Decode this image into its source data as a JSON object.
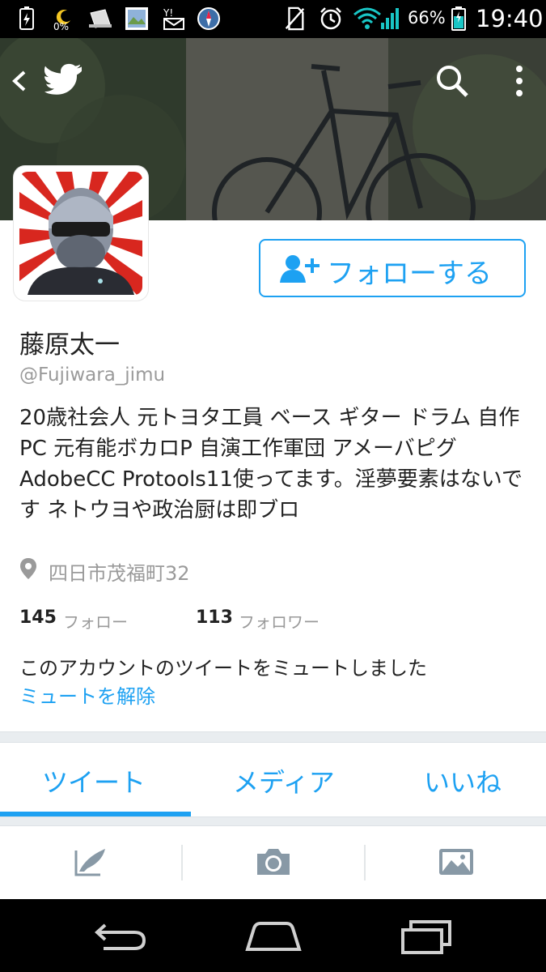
{
  "status_bar": {
    "battery_small_pct": "0%",
    "battery_pct": "66%",
    "time": "19:40",
    "icons": [
      "battery-charging-icon",
      "moon-icon",
      "hat-icon",
      "photo-icon",
      "yahoo-mail-icon",
      "compass-icon",
      "no-sim-icon",
      "alarm-icon",
      "wifi-icon",
      "signal-icon",
      "battery-icon"
    ]
  },
  "header": {
    "back_icon": "back-chevron-icon",
    "app_icon": "twitter-bird-icon",
    "search_icon": "search-icon",
    "menu_icon": "overflow-menu-icon"
  },
  "profile": {
    "follow_label": "フォローする",
    "name": "藤原太一",
    "handle": "@Fujiwara_jimu",
    "bio": "20歳社会人 元トヨタ工員 ベース ギター ドラム 自作PC 元有能ボカロP 自演工作軍団 アメーバピグ AdobeCC Protools11使ってます。淫夢要素はないです ネトウヨや政治厨は即ブロ",
    "location": "四日市茂福町32",
    "following_count": "145",
    "following_label": "フォロー",
    "followers_count": "113",
    "followers_label": "フォロワー",
    "muted_message": "このアカウントのツイートをミュートしました",
    "unmute_label": "ミュートを解除"
  },
  "tabs": {
    "items": [
      {
        "label": "ツイート",
        "active": true
      },
      {
        "label": "メディア",
        "active": false
      },
      {
        "label": "いいね",
        "active": false
      }
    ]
  },
  "compose_bar": {
    "icons": [
      "compose-tweet-icon",
      "camera-icon",
      "image-icon"
    ]
  },
  "nav_bar": {
    "icons": [
      "nav-back-icon",
      "nav-home-icon",
      "nav-recents-icon"
    ]
  },
  "colors": {
    "accent": "#1da1f2",
    "text": "#222222",
    "secondary_text": "#9a9a9a",
    "divider": "#e9edf0"
  }
}
